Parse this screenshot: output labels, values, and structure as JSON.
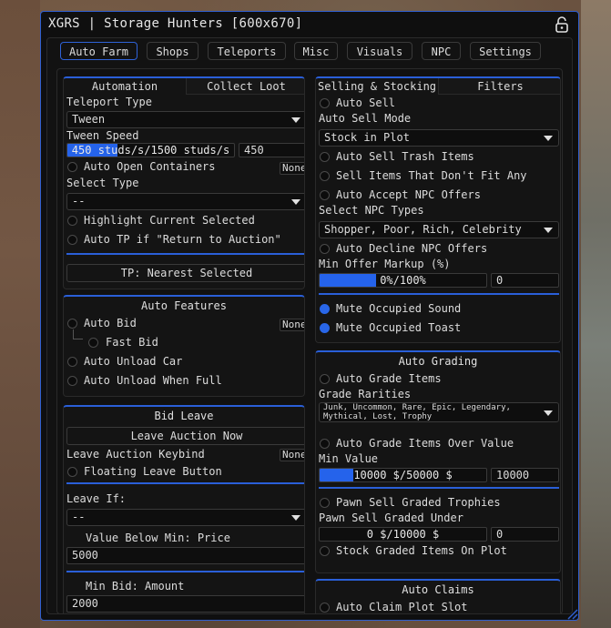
{
  "window": {
    "title": "XGRS | Storage Hunters [600x670]"
  },
  "tabs": [
    {
      "label": "Auto Farm",
      "active": true
    },
    {
      "label": "Shops",
      "active": false
    },
    {
      "label": "Teleports",
      "active": false
    },
    {
      "label": "Misc",
      "active": false
    },
    {
      "label": "Visuals",
      "active": false
    },
    {
      "label": "NPC",
      "active": false
    },
    {
      "label": "Settings",
      "active": false
    }
  ],
  "left": {
    "automation": {
      "subtabs": [
        "Automation",
        "Collect Loot"
      ],
      "teleport_type_label": "Teleport Type",
      "teleport_type_value": "Tween",
      "tween_speed_label": "Tween Speed",
      "tween_speed_text": "450 studs/s/1500 studs/s",
      "tween_speed_fraction": 0.3,
      "tween_speed_input": "450",
      "auto_open_containers": "Auto Open Containers",
      "auto_open_keybind": "None",
      "select_type_label": "Select Type",
      "select_type_value": "--",
      "highlight_current": "Highlight Current Selected",
      "auto_tp_return": "Auto TP if \"Return to Auction\"",
      "tp_nearest_button": "TP: Nearest Selected"
    },
    "auto_features": {
      "title": "Auto Features",
      "auto_bid": "Auto Bid",
      "auto_bid_keybind": "None",
      "fast_bid": "Fast Bid",
      "auto_unload_car": "Auto Unload Car",
      "auto_unload_full": "Auto Unload When Full"
    },
    "bid_leave": {
      "title": "Bid Leave",
      "leave_now_button": "Leave Auction Now",
      "leave_keybind_label": "Leave Auction Keybind",
      "leave_keybind_value": "None",
      "floating_leave": "Floating Leave Button",
      "leave_if_label": "Leave If:",
      "leave_if_value": "--",
      "value_below_label": "Value Below Min: Price",
      "value_below_input": "5000",
      "min_bid_label": "Min Bid: Amount",
      "min_bid_input": "2000"
    }
  },
  "right": {
    "selling": {
      "subtabs": [
        "Selling & Stocking",
        "Filters"
      ],
      "auto_sell": "Auto Sell",
      "auto_sell_mode_label": "Auto Sell Mode",
      "auto_sell_mode_value": "Stock in Plot",
      "auto_sell_trash": "Auto Sell Trash Items",
      "sell_dont_fit": "Sell Items That Don't Fit Any",
      "auto_accept_npc": "Auto Accept NPC Offers",
      "select_npc_label": "Select NPC Types",
      "select_npc_value": "Shopper, Poor, Rich, Celebrity",
      "auto_decline_npc": "Auto Decline NPC Offers",
      "min_offer_label": "Min Offer Markup (%)",
      "min_offer_text": "0%/100%",
      "min_offer_fraction": 0.0,
      "min_offer_input": "0",
      "mute_sound": "Mute Occupied Sound",
      "mute_toast": "Mute Occupied Toast"
    },
    "auto_grading": {
      "title": "Auto Grading",
      "auto_grade": "Auto Grade Items",
      "rarities_label": "Grade Rarities",
      "rarities_line1": "Junk, Uncommon, Rare, Epic, Legendary,",
      "rarities_line2": "Mythical, Lost, Trophy",
      "grade_over_value": "Auto Grade Items Over Value",
      "min_value_label": "Min Value",
      "min_value_text": "10000 $/50000 $",
      "min_value_fraction": 0.2,
      "min_value_input": "10000",
      "pawn_sell": "Pawn Sell Graded Trophies",
      "pawn_under_label": "Pawn Sell Graded Under",
      "pawn_under_text": "0 $/10000 $",
      "pawn_under_input": "0",
      "stock_graded": "Stock Graded Items On Plot"
    },
    "auto_claims": {
      "title": "Auto Claims",
      "auto_claim": "Auto Claim Plot Slot"
    }
  },
  "colors": {
    "accent": "#2a5fd8",
    "window_bg": "#0f0f0f"
  }
}
